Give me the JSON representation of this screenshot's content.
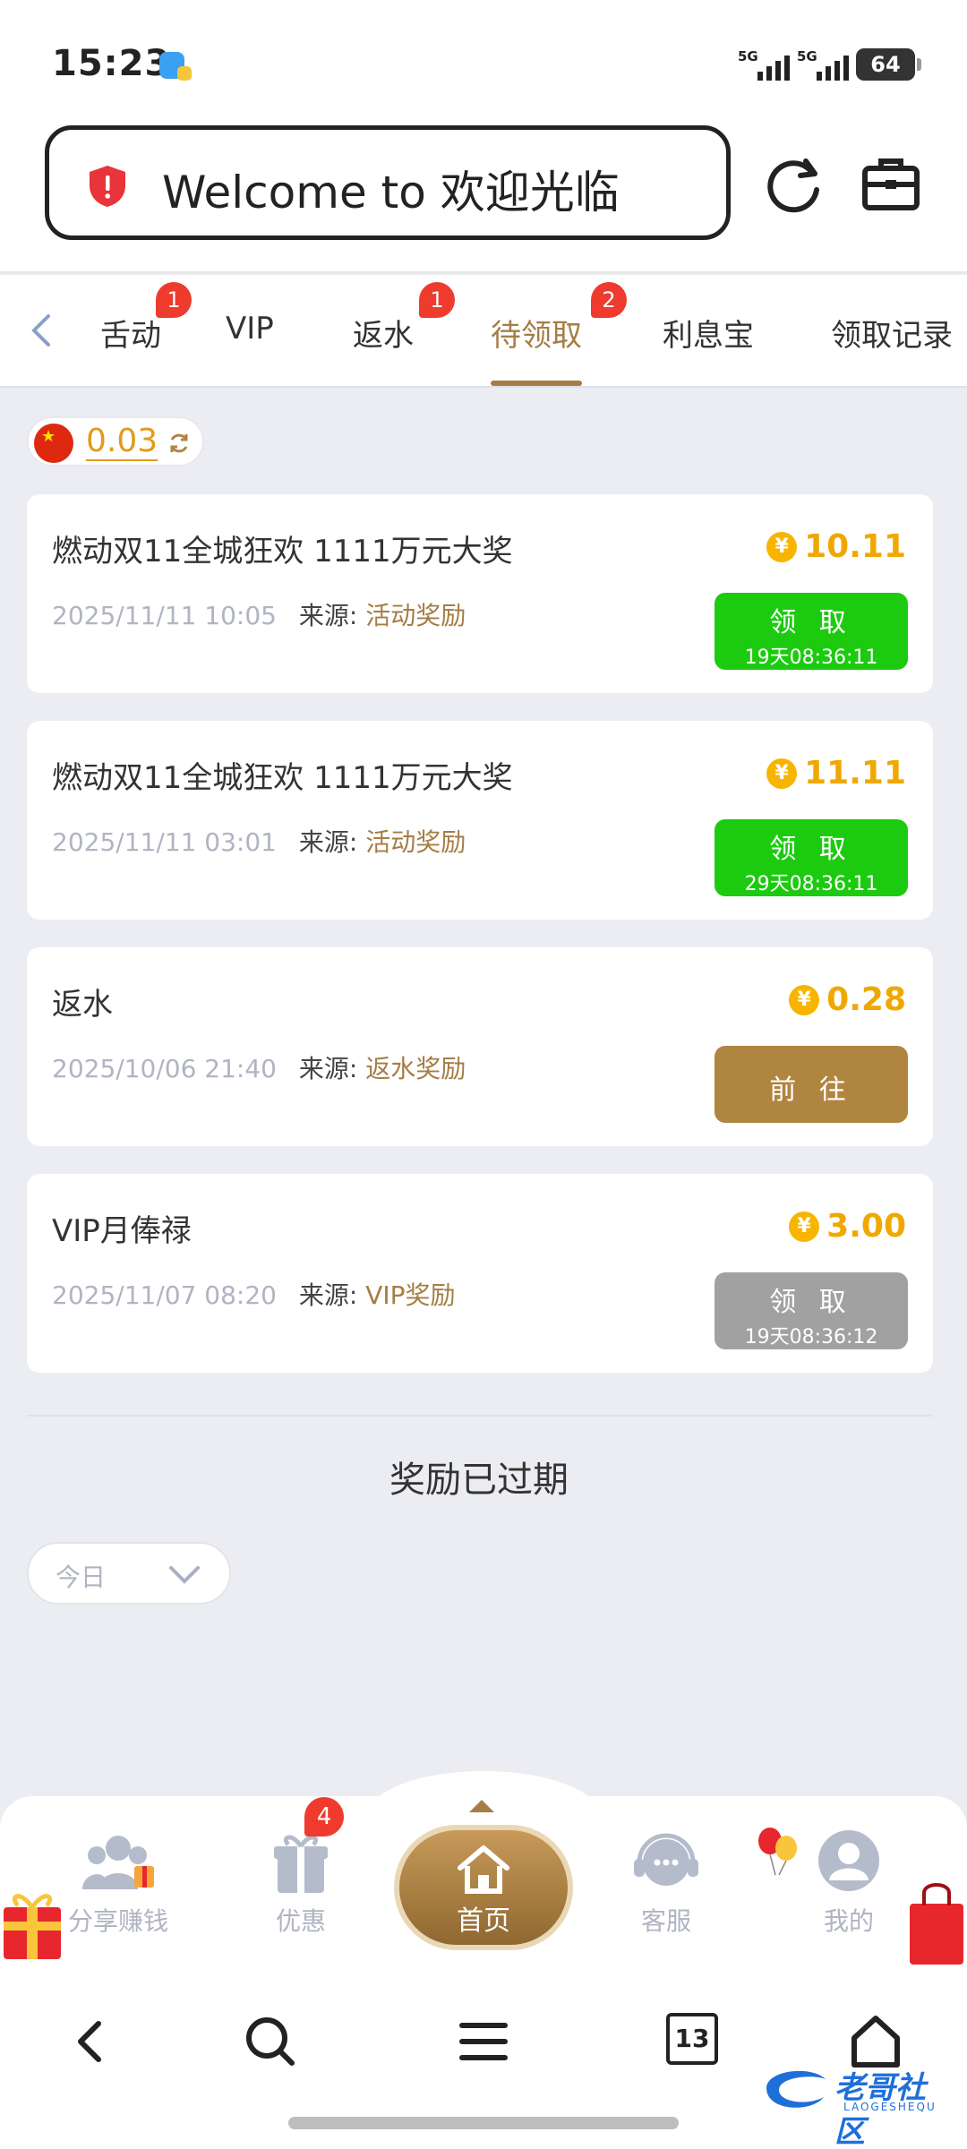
{
  "status_bar": {
    "time": "15:23",
    "signal1": "5G",
    "signal2": "5G",
    "battery": "64"
  },
  "url_bar": {
    "text": "Welcome to 欢迎光临"
  },
  "tabs": [
    {
      "label": "舌动",
      "badge": "1"
    },
    {
      "label": "VIP",
      "badge": ""
    },
    {
      "label": "返水",
      "badge": "1"
    },
    {
      "label": "待领取",
      "badge": "2",
      "active": true
    },
    {
      "label": "利息宝",
      "badge": ""
    },
    {
      "label": "领取记录",
      "badge": ""
    }
  ],
  "balance": {
    "amount": "0.03"
  },
  "rewards": [
    {
      "title": "燃动双11全城狂欢 1111万元大奖",
      "date": "2025/11/11 10:05",
      "source_label": "来源:",
      "source": "活动奖励",
      "currency": "¥",
      "amount": "10.11",
      "button": "领 取",
      "timer": "19天08:36:11",
      "state": "green"
    },
    {
      "title": "燃动双11全城狂欢 1111万元大奖",
      "date": "2025/11/11 03:01",
      "source_label": "来源:",
      "source": "活动奖励",
      "currency": "¥",
      "amount": "11.11",
      "button": "领 取",
      "timer": "29天08:36:11",
      "state": "green"
    },
    {
      "title": "返水",
      "date": "2025/10/06 21:40",
      "source_label": "来源:",
      "source": "返水奖励",
      "currency": "¥",
      "amount": "0.28",
      "button": "前 往",
      "timer": "",
      "state": "brown"
    },
    {
      "title": "VIP月俸禄",
      "date": "2025/11/07 08:20",
      "source_label": "来源:",
      "source": "VIP奖励",
      "currency": "¥",
      "amount": "3.00",
      "button": "领 取",
      "timer": "19天08:36:12",
      "state": "gray"
    }
  ],
  "expired_title": "奖励已过期",
  "filter": {
    "value": "今日"
  },
  "bottom_nav": {
    "share": "分享赚钱",
    "offers": "优惠",
    "offers_badge": "4",
    "home": "首页",
    "service": "客服",
    "mine": "我的"
  },
  "browser_bar": {
    "tabs_count": "13"
  },
  "watermark": {
    "text": "老哥社区",
    "sub": "LAOGESHEQU"
  },
  "colors": {
    "accent": "#a57d45",
    "claim_green": "#1ccb0f",
    "gold": "#f0a800",
    "badge_red": "#ee3b2d",
    "disabled_gray": "#a1a1a1"
  }
}
